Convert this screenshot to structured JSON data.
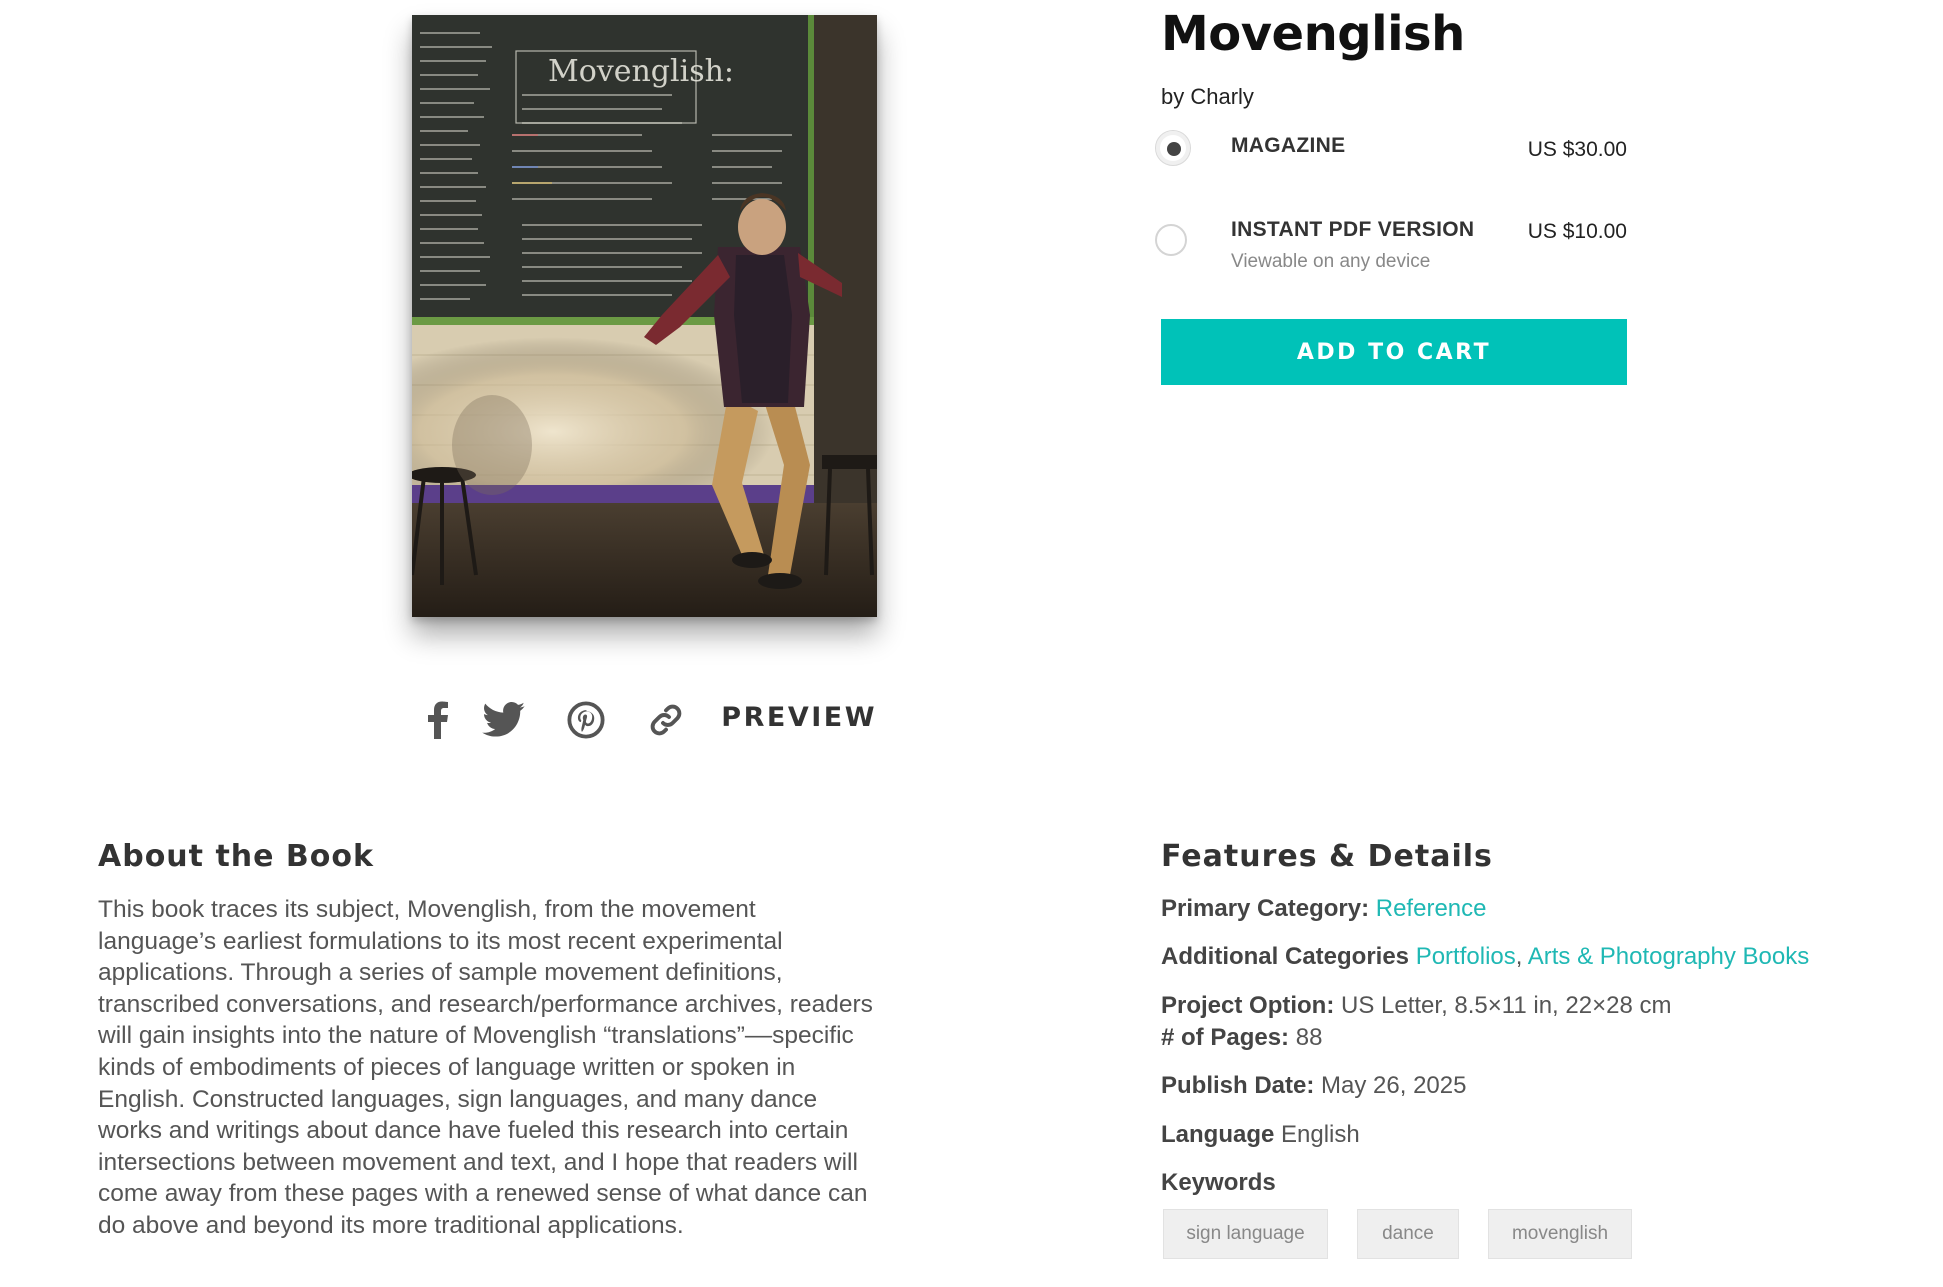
{
  "product": {
    "title": "Movenglish",
    "byline": "by Charly"
  },
  "cover": {
    "chalkboard_heading": "Movenglish:",
    "chalkboard_subtitle": "a movement language in progress that seeks to embody the nuances of English via word-for-word correspondence"
  },
  "options": [
    {
      "label": "MAGAZINE",
      "price": "US $30.00",
      "subtext": "",
      "selected": true
    },
    {
      "label": "INSTANT PDF VERSION",
      "price": "US $10.00",
      "subtext": "Viewable on any device",
      "selected": false
    }
  ],
  "actions": {
    "add_to_cart": "ADD TO CART",
    "preview": "PREVIEW"
  },
  "share_icons": [
    "facebook-icon",
    "twitter-icon",
    "pinterest-icon",
    "link-icon"
  ],
  "about": {
    "heading": "About the Book",
    "text": "This book traces its subject, Movenglish, from the movement language’s earliest formulations to its most recent experimental applications. Through a series of sample movement definitions, transcribed conversations, and research/performance archives, readers will gain insights into the nature of Movenglish “translations”––specific kinds of embodiments of pieces of language written or spoken in English. Constructed languages, sign languages, and many dance works and writings about dance have fueled this research into certain intersections between movement and text, and I hope that readers will come away from these pages with a renewed sense of what dance can do above and beyond its more traditional applications."
  },
  "features": {
    "heading": "Features & Details",
    "primary_category_label": "Primary Category:",
    "primary_category_value": "Reference",
    "additional_categories_label": "Additional Categories",
    "additional_categories": [
      "Portfolios",
      "Arts & Photography Books"
    ],
    "category_separator": ",",
    "project_option_label": "Project Option:",
    "project_option_value": "US Letter, 8.5×11 in, 22×28 cm",
    "pages_label": "# of Pages:",
    "pages_value": "88",
    "publish_date_label": "Publish Date:",
    "publish_date_value": "May 26, 2025",
    "language_label": "Language",
    "language_value": "English",
    "keywords_label": "Keywords",
    "keywords": [
      "sign language",
      "dance",
      "movenglish"
    ]
  },
  "colors": {
    "accent": "#00c2b8",
    "link": "#1fb8b4",
    "text": "#333333",
    "muted": "#888888"
  }
}
